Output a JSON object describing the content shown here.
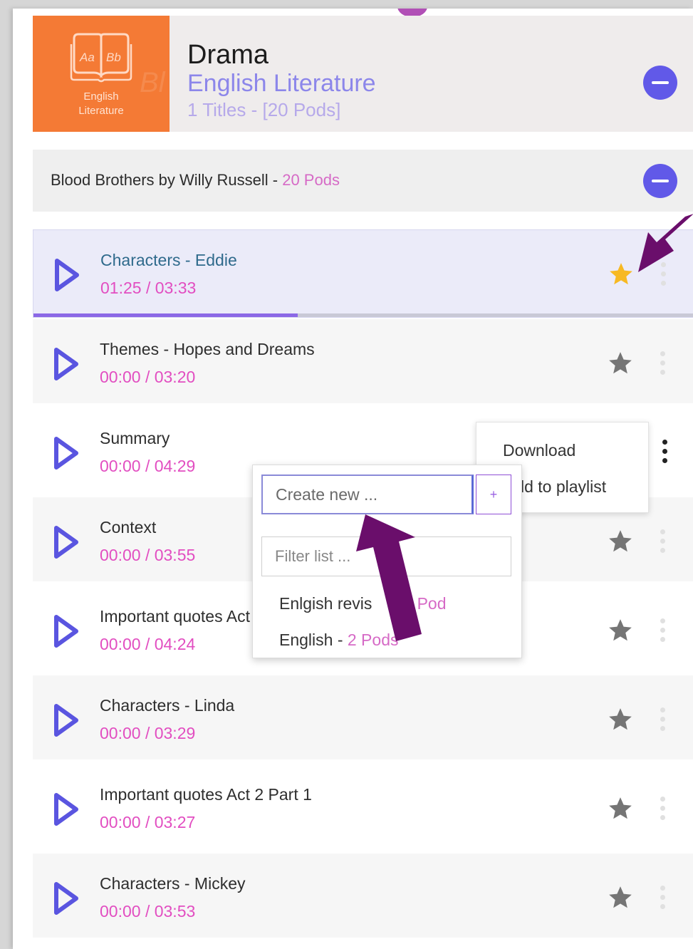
{
  "header": {
    "tile_label_line1": "English",
    "tile_label_line2": "Literature",
    "tile_book_left": "Aa",
    "tile_book_right": "Bb",
    "category": "Drama",
    "subject": "English Literature",
    "meta": "1 Titles - [20 Pods]"
  },
  "title_bar": {
    "title": "Blood Brothers by Willy Russell - ",
    "pods": "20 Pods"
  },
  "pods": [
    {
      "title": "Characters - Eddie",
      "time": "01:25 / 03:33",
      "favorite": true,
      "progress": 0.4
    },
    {
      "title": "Themes - Hopes and Dreams",
      "time": "00:00 / 03:20",
      "favorite": false
    },
    {
      "title": "Summary",
      "time": "00:00 / 04:29",
      "favorite": false
    },
    {
      "title": "Context",
      "time": "00:00 / 03:55",
      "favorite": false
    },
    {
      "title": "Important quotes Act",
      "time": "00:00 / 04:24",
      "favorite": false
    },
    {
      "title": "Characters - Linda",
      "time": "00:00 / 03:29",
      "favorite": false
    },
    {
      "title": "Important quotes Act 2 Part 1",
      "time": "00:00 / 03:27",
      "favorite": false
    },
    {
      "title": "Characters - Mickey",
      "time": "00:00 / 03:53",
      "favorite": false
    }
  ],
  "context_menu": {
    "download": "Download",
    "add_to_playlist": "ld to playlist"
  },
  "playlist_popup": {
    "create_placeholder": "Create new ...",
    "plus": "+",
    "filter_placeholder": "Filter list ...",
    "items": [
      {
        "name": "Enlgish revis",
        "pods": "1 Pod"
      },
      {
        "name": "English - ",
        "pods": "2 Pods"
      }
    ]
  },
  "colors": {
    "accent": "#6159e8",
    "time_pink": "#e24ec1",
    "tile_orange": "#f47a35",
    "star_active": "#f7b923",
    "star_inactive": "#757575",
    "annotation_arrow": "#6a0e6b"
  }
}
